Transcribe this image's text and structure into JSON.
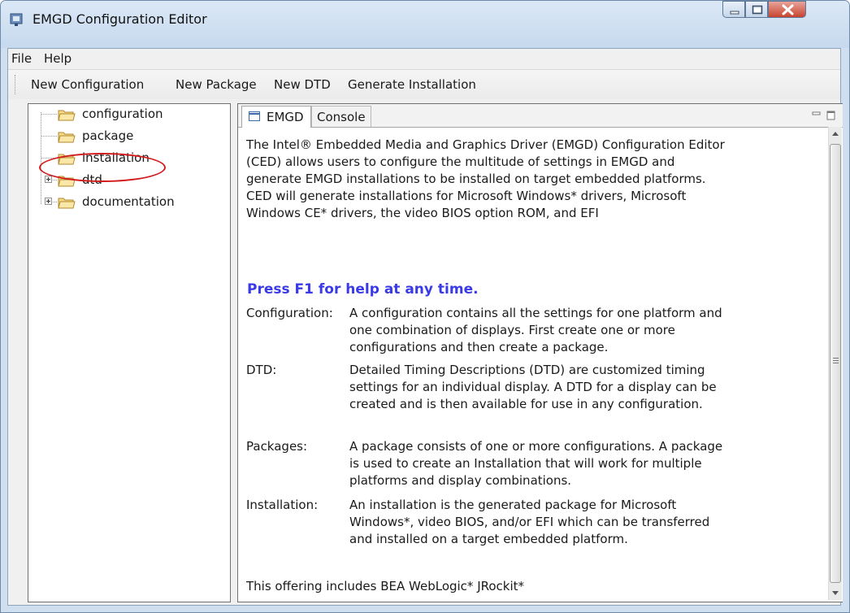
{
  "window": {
    "title": "EMGD Configuration Editor",
    "controls": [
      "minimize-icon",
      "maximize-icon",
      "close-icon"
    ]
  },
  "menu": {
    "items": [
      "File",
      "Help"
    ]
  },
  "toolbar": {
    "buttons": [
      "New Configuration",
      "New Package",
      "New DTD",
      "Generate Installation"
    ]
  },
  "tree": {
    "items": [
      {
        "label": "configuration",
        "expandable": false,
        "icon": "folder-icon"
      },
      {
        "label": "package",
        "expandable": false,
        "icon": "folder-icon"
      },
      {
        "label": "installation",
        "expandable": false,
        "icon": "folder-icon",
        "highlighted": true
      },
      {
        "label": "dtd",
        "expandable": true,
        "icon": "folder-icon"
      },
      {
        "label": "documentation",
        "expandable": true,
        "icon": "folder-icon"
      }
    ]
  },
  "editor": {
    "tabs": [
      {
        "label": "EMGD",
        "active": true
      },
      {
        "label": "Console",
        "active": false
      }
    ],
    "intro": "The Intel® Embedded Media and Graphics Driver (EMGD) Configuration Editor (CED) allows users to configure the multitude of settings in EMGD and generate EMGD installations to be installed on target embedded platforms.  CED will generate installations for Microsoft Windows* drivers, Microsoft Windows CE* drivers, the video BIOS option ROM, and EFI",
    "press_help": "Press F1 for help at any time.",
    "definitions": [
      {
        "term": "Configuration:",
        "desc": "A configuration contains all the settings for one platform and one combination of displays.  First create one or more configurations and then create a package."
      },
      {
        "term": "DTD:",
        "desc": "Detailed Timing Descriptions (DTD) are customized timing settings for an individual display.  A DTD for a display can be created and is then available for use in any configuration."
      },
      {
        "term": "Packages:",
        "desc": "A package consists of one or more configurations.  A package is used to create an Installation that will work for multiple platforms and display combinations."
      },
      {
        "term": "Installation:",
        "desc": "An installation is the generated package for Microsoft Windows*, video BIOS, and/or EFI which can be transferred and installed on a target embedded platform."
      }
    ],
    "footer": "This offering includes BEA WebLogic* JRockit*"
  },
  "colors": {
    "accent_help_text": "#3a3ae6",
    "highlight_circle": "#d11c1c",
    "close_button": "#c8452f"
  }
}
